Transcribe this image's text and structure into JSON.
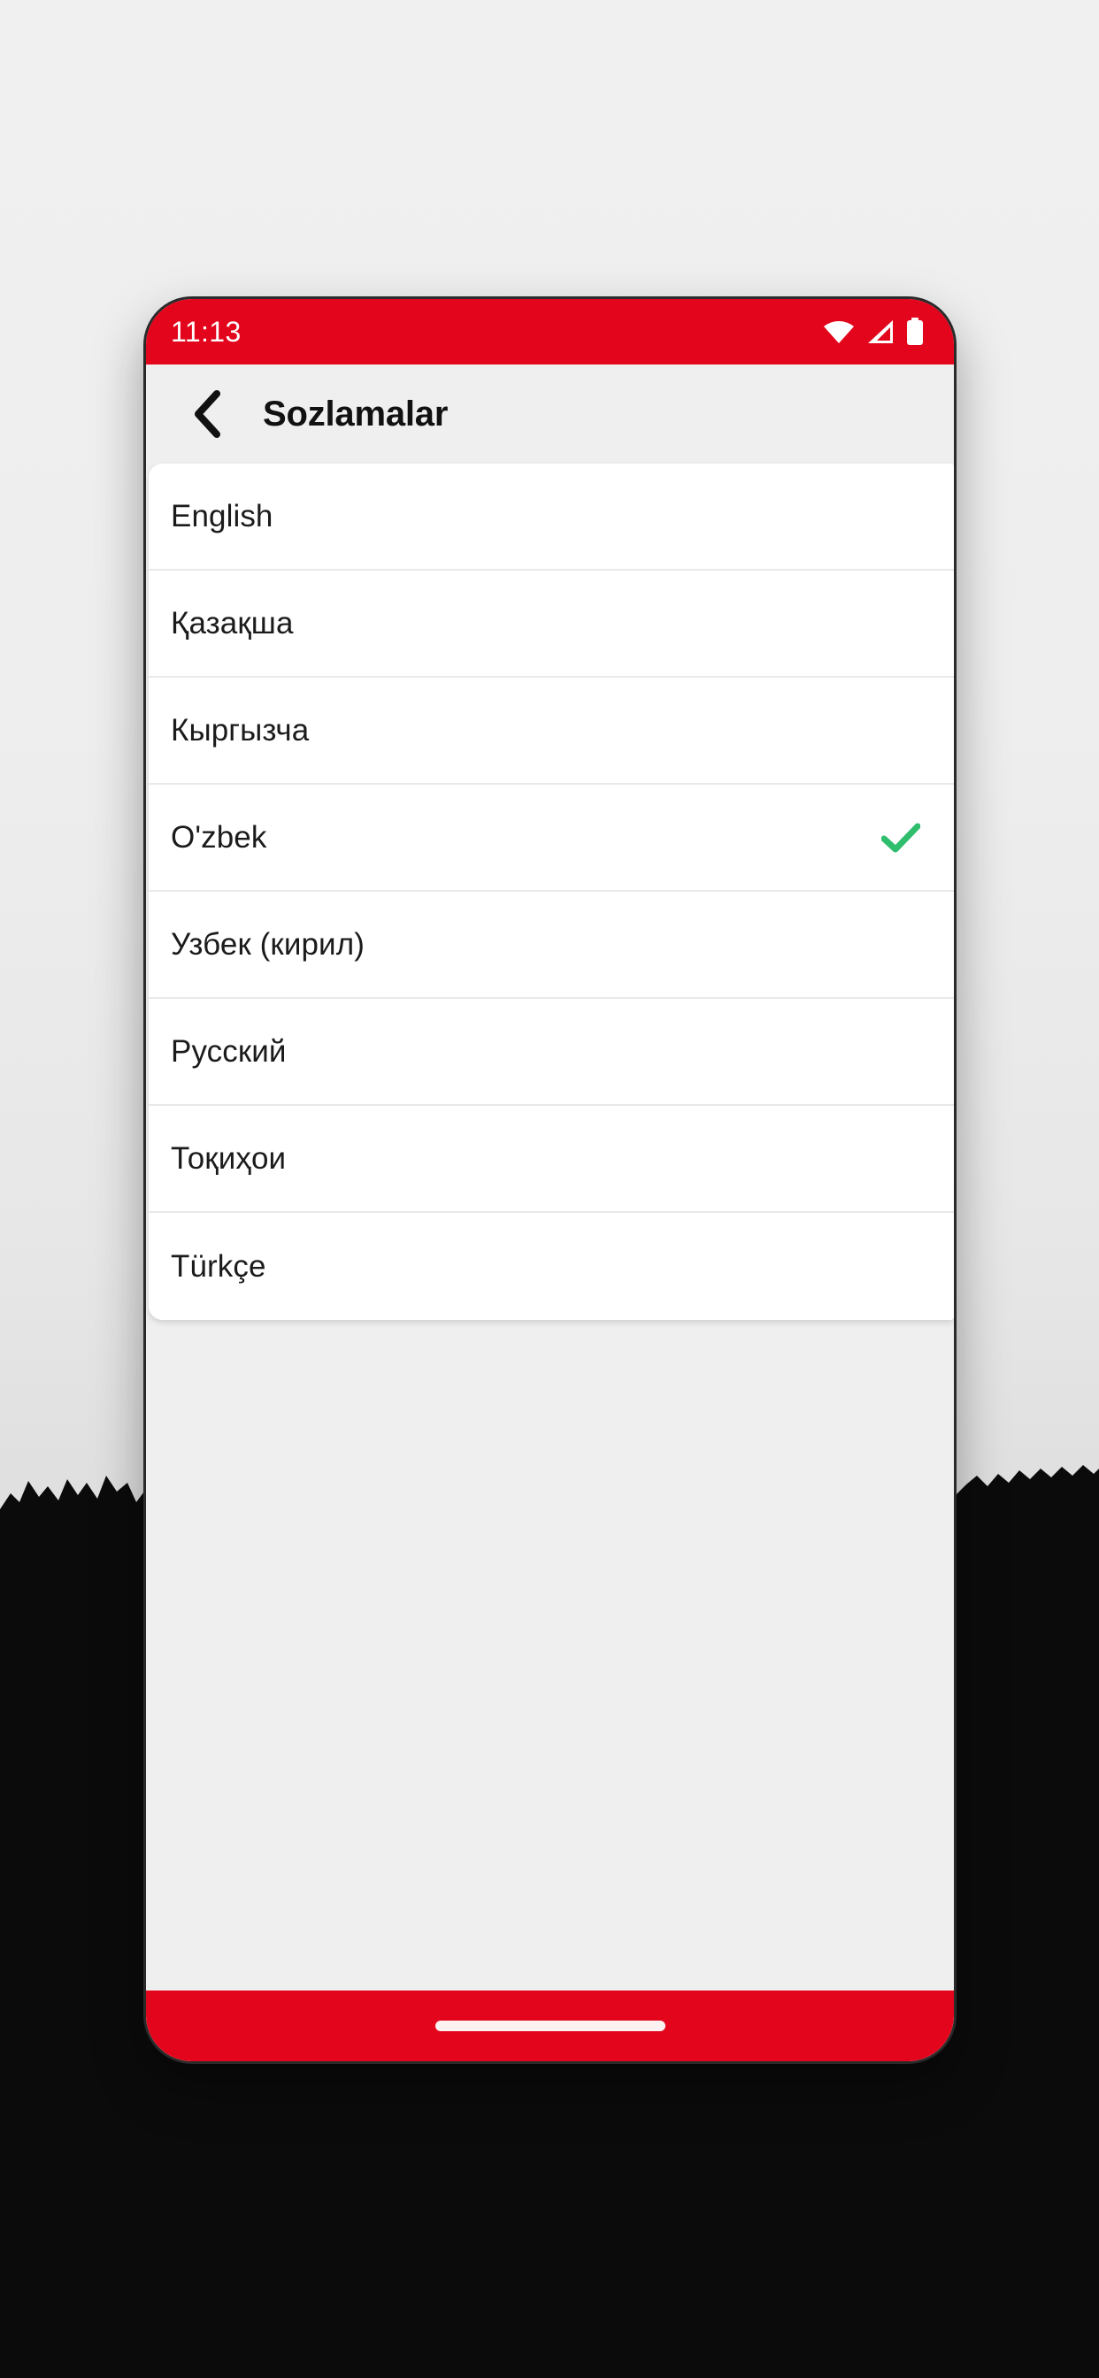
{
  "theme": {
    "brand_red": "#e3051b",
    "check_green": "#2fbe6e",
    "screen_bg": "#efefef",
    "card_bg": "#ffffff",
    "text_primary": "#1b1b1b"
  },
  "status_bar": {
    "time": "11:13",
    "icons": [
      "wifi-icon",
      "cellular-signal-icon",
      "battery-icon"
    ]
  },
  "app_bar": {
    "back_icon": "chevron-left-icon",
    "title": "Sozlamalar"
  },
  "language_list": {
    "selected_index": 3,
    "selected_value": "O'zbek",
    "check_icon": "check-icon",
    "items": [
      {
        "label": "English",
        "selected": false
      },
      {
        "label": "Қазақша",
        "selected": false
      },
      {
        "label": "Кыргызча",
        "selected": false
      },
      {
        "label": "O'zbek",
        "selected": true
      },
      {
        "label": "Узбек (кирил)",
        "selected": false
      },
      {
        "label": "Русский",
        "selected": false
      },
      {
        "label": "Тоқиҳои",
        "selected": false
      },
      {
        "label": "Türkçe",
        "selected": false
      }
    ]
  },
  "nav_bar": {
    "gesture_handle": "home-gesture-pill"
  }
}
